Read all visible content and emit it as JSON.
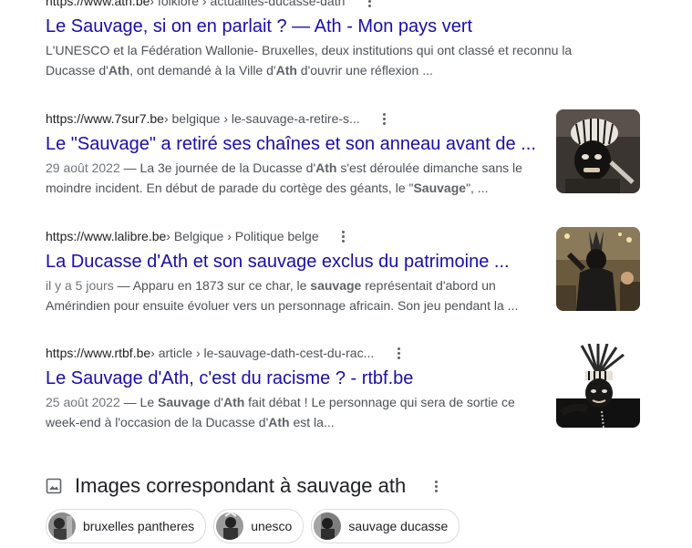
{
  "results": [
    {
      "domain": "https://www.ath.be",
      "path": " › folklore › actualites-ducasse-dath",
      "title": "Le Sauvage, si on en parlait ? — Ath - Mon pays vert",
      "snippet_lines": [
        [
          {
            "t": "L'UNESCO et la Fédération Wallonie- Bruxelles, deux institutions qui ont classé et reconnu la"
          }
        ],
        [
          {
            "t": "Ducasse d'"
          },
          {
            "t": "Ath",
            "b": true
          },
          {
            "t": ", ont demandé à la Ville d'"
          },
          {
            "t": "Ath",
            "b": true
          },
          {
            "t": " d'ouvrir une réflexion ..."
          }
        ]
      ]
    },
    {
      "domain": "https://www.7sur7.be",
      "path": " › belgique › le-sauvage-a-retire-s...",
      "title": "Le \"Sauvage\" a retiré ses chaînes et son anneau avant de ...",
      "snippet_lines": [
        [
          {
            "t": "29 août 2022",
            "d": true
          },
          {
            "t": " — La 3e journée de la Ducasse d'"
          },
          {
            "t": "Ath",
            "b": true
          },
          {
            "t": " s'est déroulée dimanche sans le"
          }
        ],
        [
          {
            "t": "moindre incident. En début de parade du cortège des géants, le \""
          },
          {
            "t": "Sauvage",
            "b": true
          },
          {
            "t": "\", ..."
          }
        ]
      ]
    },
    {
      "domain": "https://www.lalibre.be",
      "path": " › Belgique › Politique belge",
      "title": "La Ducasse d'Ath et son sauvage exclus du patrimoine ...",
      "snippet_lines": [
        [
          {
            "t": "il y a 5 jours",
            "d": true
          },
          {
            "t": " — Apparu en 1873 sur ce char, le "
          },
          {
            "t": "sauvage",
            "b": true
          },
          {
            "t": " représentait d'abord un"
          }
        ],
        [
          {
            "t": "Amérindien pour ensuite évoluer vers un personnage africain. Son jeu pendant la ..."
          }
        ]
      ]
    },
    {
      "domain": "https://www.rtbf.be",
      "path": " › article › le-sauvage-dath-cest-du-rac...",
      "title": "Le Sauvage d'Ath, c'est du racisme ? - rtbf.be",
      "snippet_lines": [
        [
          {
            "t": "25 août 2022",
            "d": true
          },
          {
            "t": " — Le "
          },
          {
            "t": "Sauvage",
            "b": true
          },
          {
            "t": " d'"
          },
          {
            "t": "Ath",
            "b": true
          },
          {
            "t": " fait débat ! Le personnage qui sera de sortie ce"
          }
        ],
        [
          {
            "t": "week-end à l'occasion de la Ducasse d'"
          },
          {
            "t": "Ath",
            "b": true
          },
          {
            "t": " est la..."
          }
        ]
      ]
    }
  ],
  "images_section": {
    "title": "Images correspondant à sauvage ath",
    "chips": [
      "bruxelles pantheres",
      "unesco",
      "sauvage ducasse"
    ]
  },
  "colors": {
    "link": "#1a0dab",
    "snippet": "#4d5156",
    "date": "#70757a",
    "chip_border": "#dadce0"
  },
  "icons": {
    "result_menu": "three-dots-vertical-icon",
    "images_header": "image-icon"
  }
}
